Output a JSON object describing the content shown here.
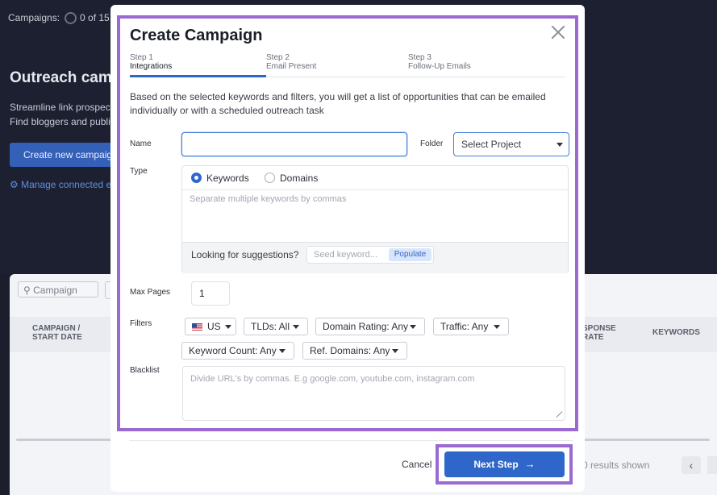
{
  "background": {
    "campaigns_label": "Campaigns:",
    "campaigns_count": "0 of 15",
    "title": "Outreach cam",
    "subtitle_line1": "Streamline link prospect",
    "subtitle_line2": "Find bloggers and publi",
    "create_button": "Create new campaig",
    "manage_link": "Manage connected e",
    "search_placeholder": "Campaign",
    "col_campaign": "CAMPAIGN /",
    "col_start_date": "START DATE",
    "col_response": "SPONSE",
    "col_rate": "RATE",
    "col_keywords": "KEYWORDS",
    "results_text": "0 results shown",
    "pager_prev": "‹"
  },
  "modal": {
    "title": "Create Campaign",
    "steps": [
      {
        "number": "Step 1",
        "label": "Integrations"
      },
      {
        "number": "Step 2",
        "label": "Email Present"
      },
      {
        "number": "Step 3",
        "label": "Follow-Up Emails"
      }
    ],
    "description": "Based on the selected keywords and filters, you will get a list of opportunities that can be emailed individually or with a scheduled outreach task",
    "name_label": "Name",
    "name_value": "",
    "folder_label": "Folder",
    "folder_value": "Select Project",
    "type_label": "Type",
    "type_options": [
      "Keywords",
      "Domains"
    ],
    "type_selected": "Keywords",
    "keywords_placeholder": "Separate multiple keywords by commas",
    "suggestions_label": "Looking for suggestions?",
    "seed_placeholder": "Seed keyword...",
    "populate_label": "Populate",
    "max_pages_label": "Max Pages",
    "max_pages_value": "1",
    "filters_label": "Filters",
    "filters": {
      "country": "US",
      "tlds": "TLDs: All",
      "domain_rating": "Domain Rating: Any",
      "traffic": "Traffic: Any",
      "keyword_count": "Keyword Count: Any",
      "ref_domains": "Ref. Domains: Any"
    },
    "blacklist_label": "Blacklist",
    "blacklist_placeholder": "Divide URL's by commas. E.g google.com, youtube.com, instagram.com",
    "cancel_label": "Cancel",
    "next_label": "Next Step",
    "next_arrow": "→"
  },
  "colors": {
    "accent": "#2f66c9",
    "highlight": "#9a6ad0",
    "overlay": "#1d2030"
  }
}
